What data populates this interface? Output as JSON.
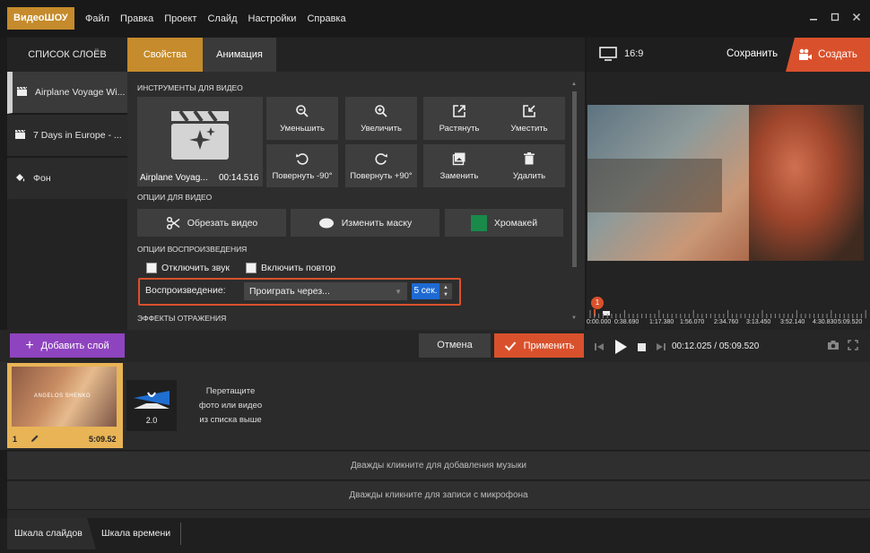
{
  "app": {
    "logo_text": "ВидеоШОУ"
  },
  "menu": [
    "Файл",
    "Правка",
    "Проект",
    "Слайд",
    "Настройки",
    "Справка"
  ],
  "layers": {
    "header": "СПИСОК СЛОЁВ",
    "items": [
      {
        "label": "Airplane Voyage Wi...",
        "icon": "film-clapper-icon"
      },
      {
        "label": "7 Days in Europe - ...",
        "icon": "film-clapper-icon"
      },
      {
        "label": "Фон",
        "icon": "paint-bucket-icon"
      }
    ]
  },
  "tabs": {
    "properties": "Свойства",
    "animation": "Анимация"
  },
  "video_tools": {
    "section_label": "ИНСТРУМЕНТЫ ДЛЯ ВИДЕО",
    "thumb_name": "Airplane Voyag...",
    "thumb_duration": "00:14.516",
    "buttons": {
      "zoom_out": "Уменьшить",
      "zoom_in": "Увеличить",
      "stretch": "Растянуть",
      "fit": "Уместить",
      "rotate_left": "Повернуть -90°",
      "rotate_right": "Повернуть +90°",
      "replace": "Заменить",
      "delete": "Удалить"
    }
  },
  "video_options": {
    "section_label": "ОПЦИИ ДЛЯ ВИДЕО",
    "trim": "Обрезать видео",
    "mask": "Изменить маску",
    "chromakey": "Хромакей"
  },
  "playback": {
    "section_label": "ОПЦИИ ВОСПРОИЗВЕДЕНИЯ",
    "mute": "Отключить звук",
    "loop": "Включить повтор",
    "label": "Воспроизведение:",
    "mode": "Проиграть через...",
    "seconds": "5 сек."
  },
  "reflection": {
    "section_label": "ЭФФЕКТЫ ОТРАЖЕНИЯ"
  },
  "preview": {
    "aspect": "16:9",
    "save": "Сохранить",
    "create": "Создать",
    "timeline_marker": "1",
    "ticks": [
      "0:00.000",
      "0:38.690",
      "1:17.380",
      "1:56.070",
      "2:34.760",
      "3:13.450",
      "3:52.140",
      "4:30.830",
      "5:09.520"
    ],
    "current_time": "00:12.025 / 05:09.520"
  },
  "actions": {
    "add_layer": "Добавить слой",
    "cancel": "Отмена",
    "apply": "Применить"
  },
  "storyboard": {
    "slide_number": "1",
    "slide_duration": "5:09.52",
    "transition_duration": "2.0",
    "drop_hint": [
      "Перетащите",
      "фото или видео",
      "из списка выше"
    ],
    "slide_caption": "ANGELOS SHENKO"
  },
  "tracks": {
    "music": "Дважды кликните для добавления музыки",
    "mic": "Дважды кликните для записи с микрофона"
  },
  "bottom_tabs": {
    "slides": "Шкала слайдов",
    "timeline": "Шкала времени"
  }
}
